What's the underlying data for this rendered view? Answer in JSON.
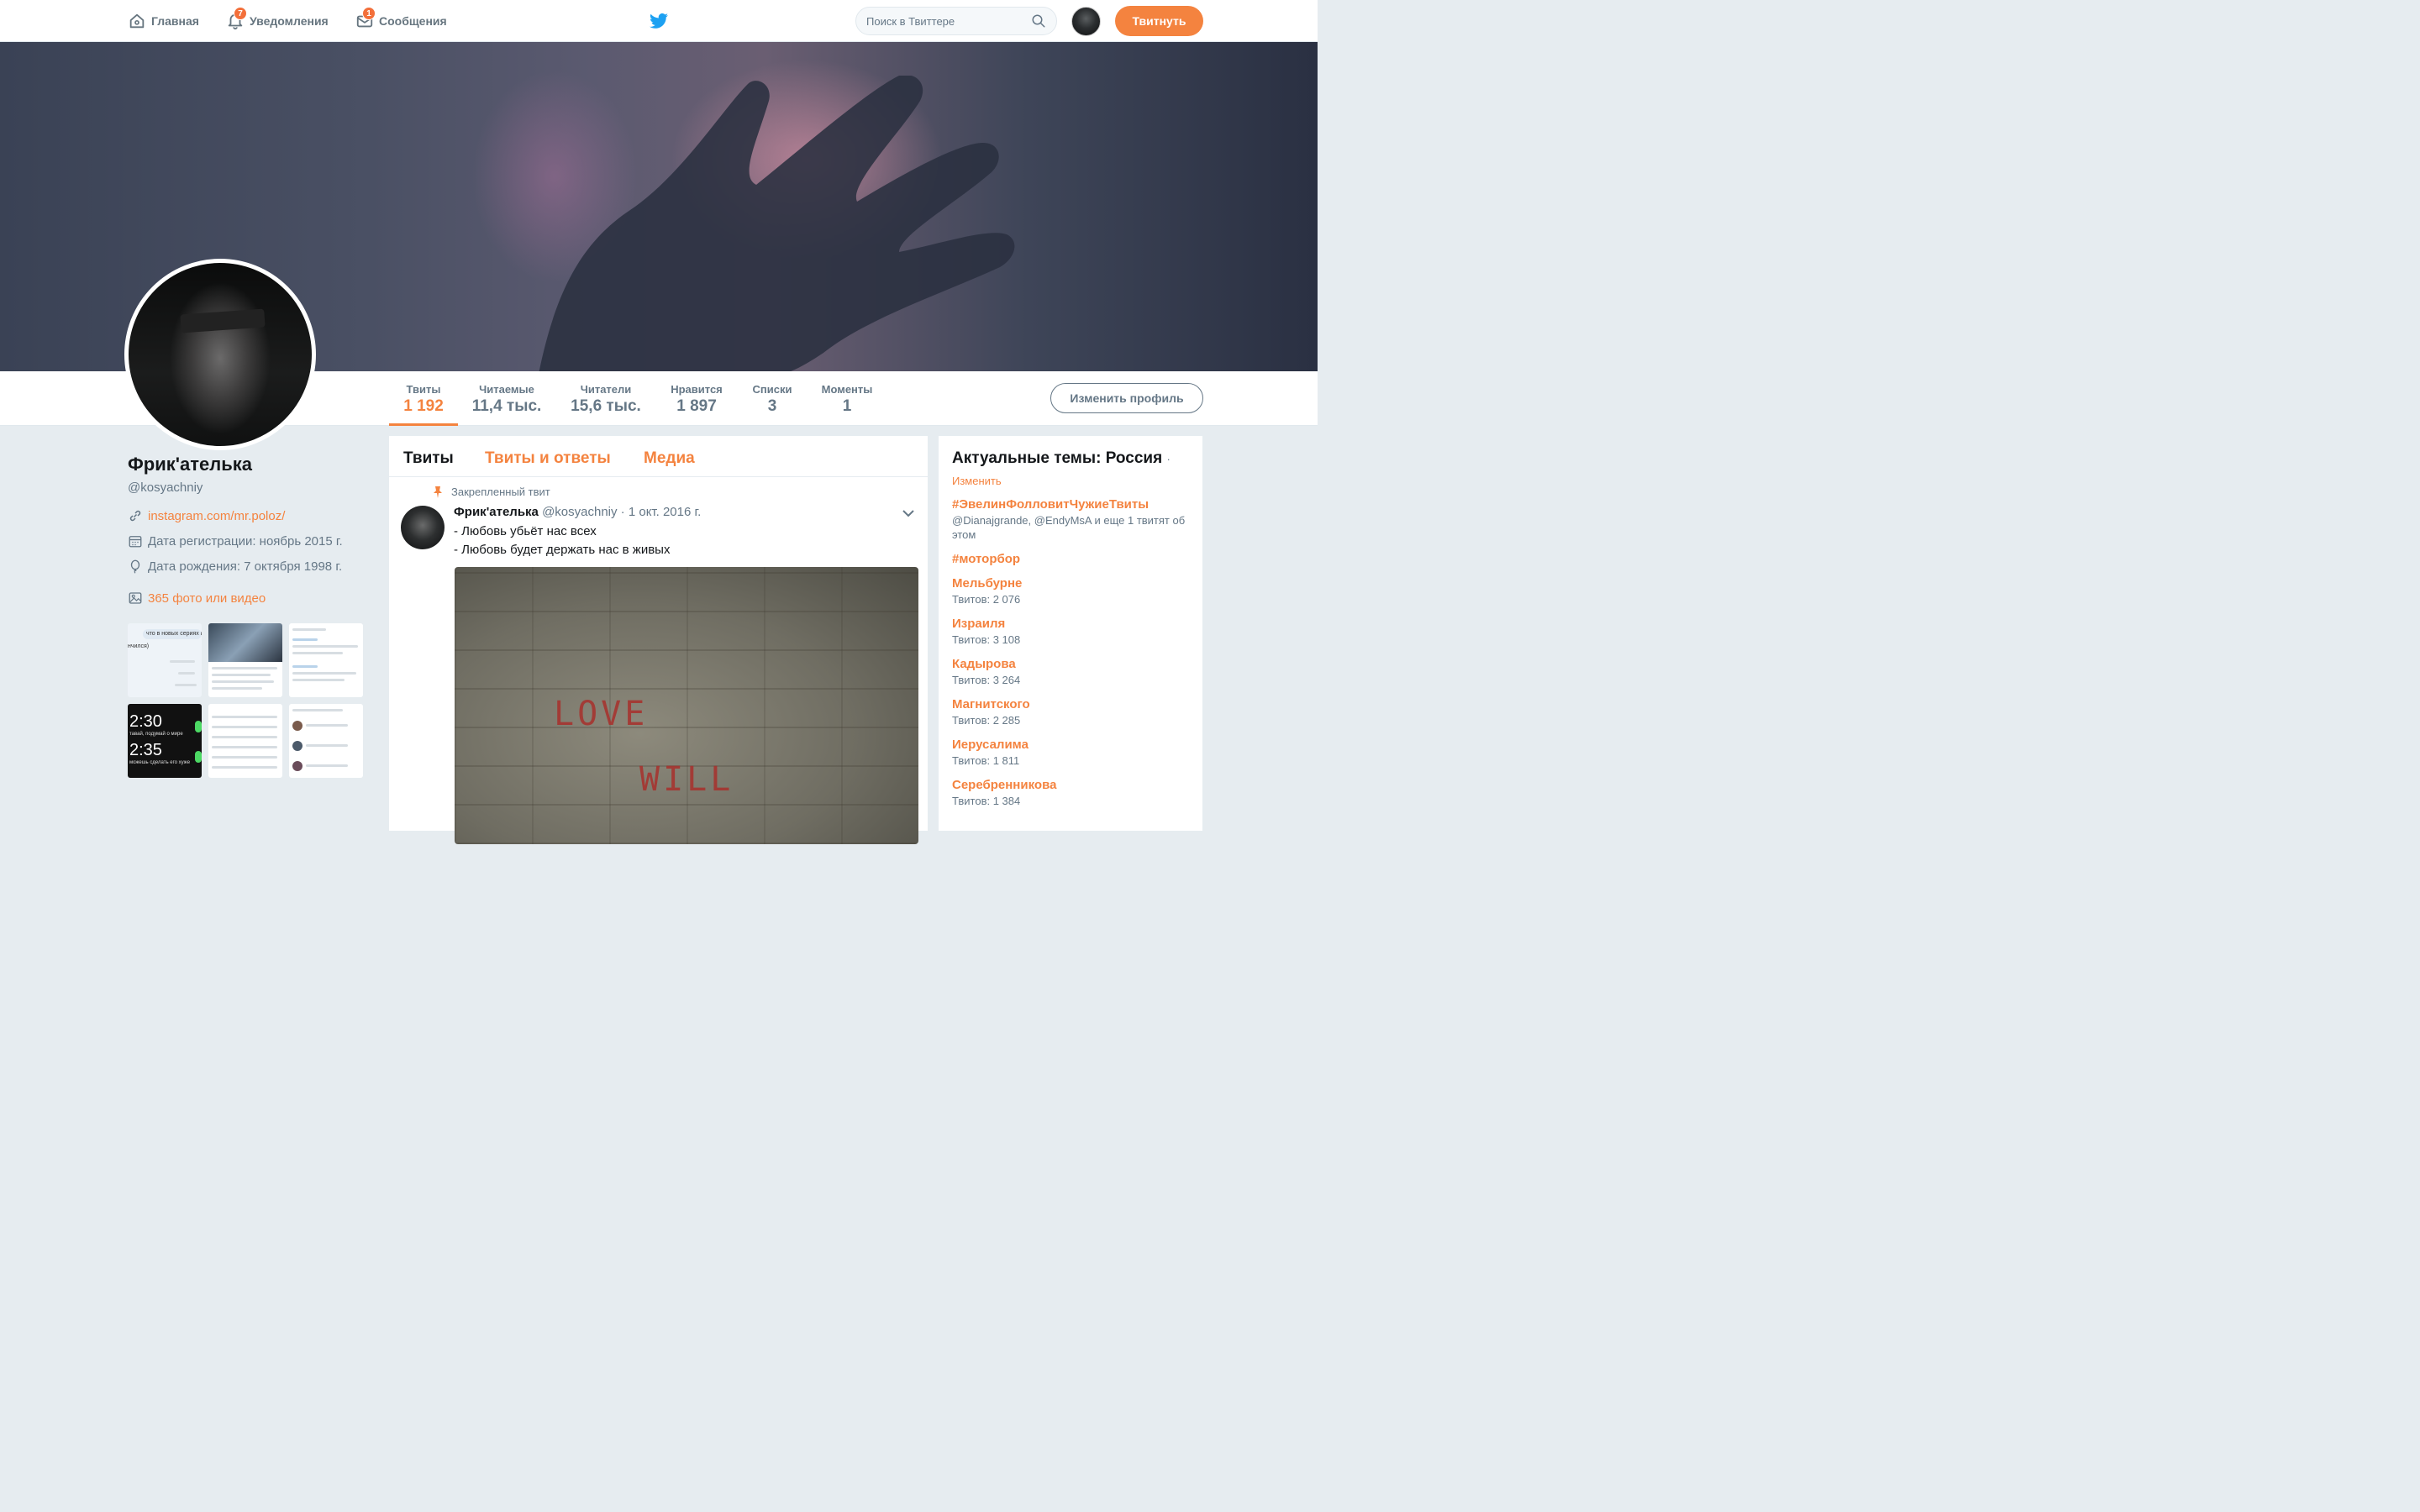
{
  "nav": {
    "home": "Главная",
    "notifications": "Уведомления",
    "notifications_badge": "7",
    "messages": "Сообщения",
    "messages_badge": "1",
    "search_placeholder": "Поиск в Твиттере",
    "tweet_button": "Твитнуть"
  },
  "profile_nav": {
    "stats": [
      {
        "label": "Твиты",
        "value": "1 192"
      },
      {
        "label": "Читаемые",
        "value": "11,4 тыс."
      },
      {
        "label": "Читатели",
        "value": "15,6 тыс."
      },
      {
        "label": "Нравится",
        "value": "1 897"
      },
      {
        "label": "Списки",
        "value": "3"
      },
      {
        "label": "Моменты",
        "value": "1"
      }
    ],
    "edit_profile": "Изменить профиль"
  },
  "profile": {
    "name": "Фрик'ателька",
    "handle": "@kosyachniy",
    "link": "instagram.com/mr.poloz/",
    "joined": "Дата регистрации: ноябрь 2015 г.",
    "birthday": "Дата рождения: 7 октября 1998 г.",
    "media_link": "365 фото или видео",
    "thumb_texts": {
      "t1_line": "что в новых сериях вс",
      "t1_line2": "нчился)",
      "t4_time1": "2:30",
      "t4_caption1": "тавай, подумай о мире",
      "t4_time2": "2:35",
      "t4_caption2": "можешь сделать его хуже"
    }
  },
  "timeline": {
    "tabs": [
      "Твиты",
      "Твиты и ответы",
      "Медиа"
    ],
    "pinned_label": "Закрепленный твит",
    "tweet": {
      "name": "Фрик'ателька",
      "meta": "@kosyachniy · 1 окт. 2016 г.",
      "line1": "- Любовь убьёт нас всех",
      "line2": "- Любовь будет держать нас в живых",
      "photo_words": [
        "LOVE",
        "WILL"
      ]
    }
  },
  "trends": {
    "title": "Актуальные темы: Россия",
    "title_dot": "·",
    "change": "Изменить",
    "items": [
      {
        "name": "#ЭвелинФолловитЧужиеТвиты",
        "meta": "@Dianajgrande, @EndyMsA и еще 1 твитят об этом"
      },
      {
        "name": "#моторбор",
        "meta": ""
      },
      {
        "name": "Мельбурне",
        "meta": "Твитов: 2 076"
      },
      {
        "name": "Израиля",
        "meta": "Твитов: 3 108"
      },
      {
        "name": "Кадырова",
        "meta": "Твитов: 3 264"
      },
      {
        "name": "Магнитского",
        "meta": "Твитов: 2 285"
      },
      {
        "name": "Иерусалима",
        "meta": "Твитов: 1 811"
      },
      {
        "name": "Серебренникова",
        "meta": "Твитов: 1 384"
      }
    ]
  },
  "colors": {
    "accent": "#f4833f",
    "badge": "#f36f3a",
    "twitter_blue": "#1da1f2",
    "muted_text": "#657786",
    "background": "#e6ecf0"
  },
  "icons": [
    "home-icon",
    "bell-icon",
    "envelope-icon",
    "twitter-bird-icon",
    "search-icon",
    "link-icon",
    "calendar-icon",
    "balloon-icon",
    "photo-icon",
    "pin-icon",
    "chevron-down-icon"
  ]
}
